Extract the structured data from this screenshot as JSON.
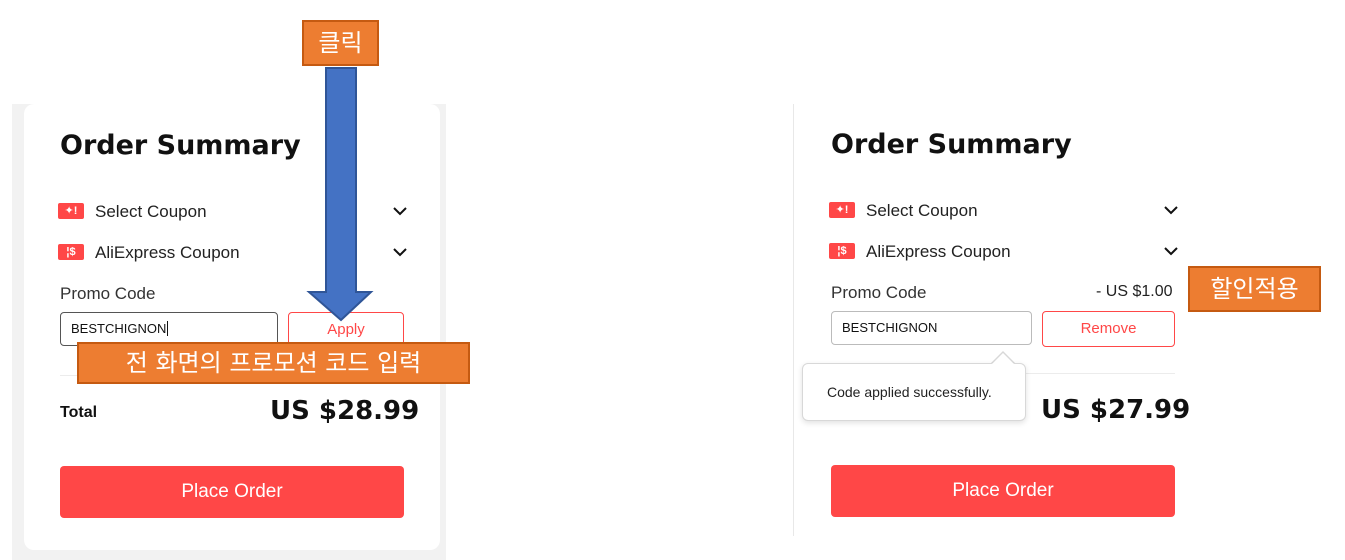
{
  "annotations": {
    "click": "클릭",
    "enter_code": "전 화면의 프로모션 코드 입력",
    "discount_applied": "할인적용"
  },
  "colors": {
    "accent": "#ff4747",
    "annotation_fill": "#ed7d31",
    "arrow_fill": "#4472c4"
  },
  "before": {
    "title": "Order Summary",
    "select_coupon": "Select Coupon",
    "aliexpress_coupon": "AliExpress Coupon",
    "promo_label": "Promo Code",
    "promo_value": "BESTCHIGNON",
    "apply_label": "Apply",
    "total_label": "Total",
    "total_value": "US $28.99",
    "place_order": "Place Order"
  },
  "after": {
    "title": "Order Summary",
    "select_coupon": "Select Coupon",
    "aliexpress_coupon": "AliExpress Coupon",
    "promo_label": "Promo Code",
    "discount": "- US $1.00",
    "promo_value": "BESTCHIGNON",
    "remove_label": "Remove",
    "tooltip": "Code applied successfully.",
    "total_value": "US $27.99",
    "place_order": "Place Order"
  },
  "icons": {
    "coupon": "coupon-ticket-icon",
    "aliexpress_coupon": "dollar-coupon-icon",
    "chevron": "chevron-down-icon",
    "arrow": "down-arrow-icon"
  }
}
